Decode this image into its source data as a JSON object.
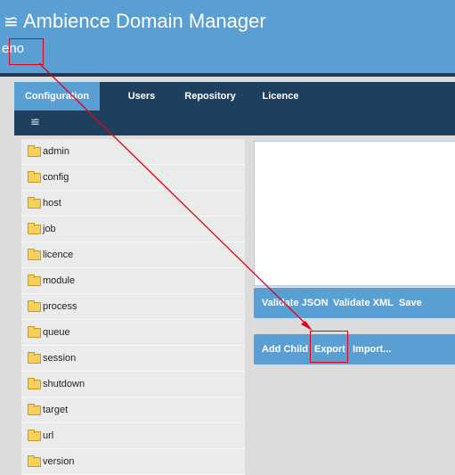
{
  "app": {
    "title": "Ambience Domain Manager",
    "domain": "eno",
    "menu_icon": "hamburger-icon"
  },
  "tabs": [
    {
      "label": "Configuration",
      "active": true
    },
    {
      "label": "Users",
      "active": false
    },
    {
      "label": "Repository",
      "active": false
    },
    {
      "label": "Licence",
      "active": false
    }
  ],
  "toolbar": {
    "icon": "menu-icon"
  },
  "sidebar": {
    "items": [
      {
        "label": "admin"
      },
      {
        "label": "config"
      },
      {
        "label": "host"
      },
      {
        "label": "job"
      },
      {
        "label": "licence"
      },
      {
        "label": "module"
      },
      {
        "label": "process"
      },
      {
        "label": "queue"
      },
      {
        "label": "session"
      },
      {
        "label": "shutdown"
      },
      {
        "label": "target"
      },
      {
        "label": "url"
      },
      {
        "label": "version"
      }
    ]
  },
  "editor": {
    "value": ""
  },
  "validate_bar": {
    "validate_json": "Validate JSON",
    "validate_xml": "Validate XML",
    "save": "Save"
  },
  "node_bar": {
    "add_child": "Add Child",
    "export": "Export",
    "import": "Import..."
  },
  "colors": {
    "header": "#5a9fd4",
    "nav": "#1f3f5f",
    "annotation": "#e0001a"
  }
}
